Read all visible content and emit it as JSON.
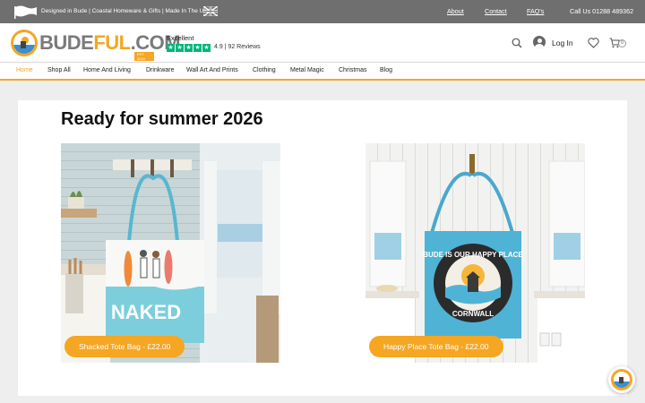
{
  "topbar": {
    "tagline": "Designed in Bude | Coastal Homeware & Gifts | Made In The UK",
    "links": [
      "About",
      "Contact",
      "FAQ's"
    ],
    "call": "Call Us  01288 489362",
    "flag_icon": "union-jack-icon"
  },
  "header": {
    "logo_grey": "BUDE",
    "logo_orange": "FUL",
    "logo_grey2": ".COM",
    "logo_sub": "EST. 2016",
    "rating_label": "Excellent",
    "rating_text": "4.9 | 92 Reviews",
    "stars": 5,
    "star_color": "#00b67a",
    "login": "Log In",
    "cart_count": "0"
  },
  "nav": {
    "items": [
      "Home",
      "Shop All",
      "Home And Living",
      "Drinkware",
      "Wall Art And Prints",
      "Clothing",
      "Metal Magic",
      "Christmas",
      "Blog"
    ],
    "active_index": 0,
    "accent": "#f5a623"
  },
  "main": {
    "heading": "Ready for summer 2026",
    "products": [
      {
        "label": "Shacked Tote Bag - £22.00",
        "bag_text": "NAKED"
      },
      {
        "label": "Happy Place Tote Bag - £22.00",
        "bag_top": "BUDE IS OUR HAPPY PLACE",
        "bag_bottom": "CORNWALL"
      }
    ]
  }
}
